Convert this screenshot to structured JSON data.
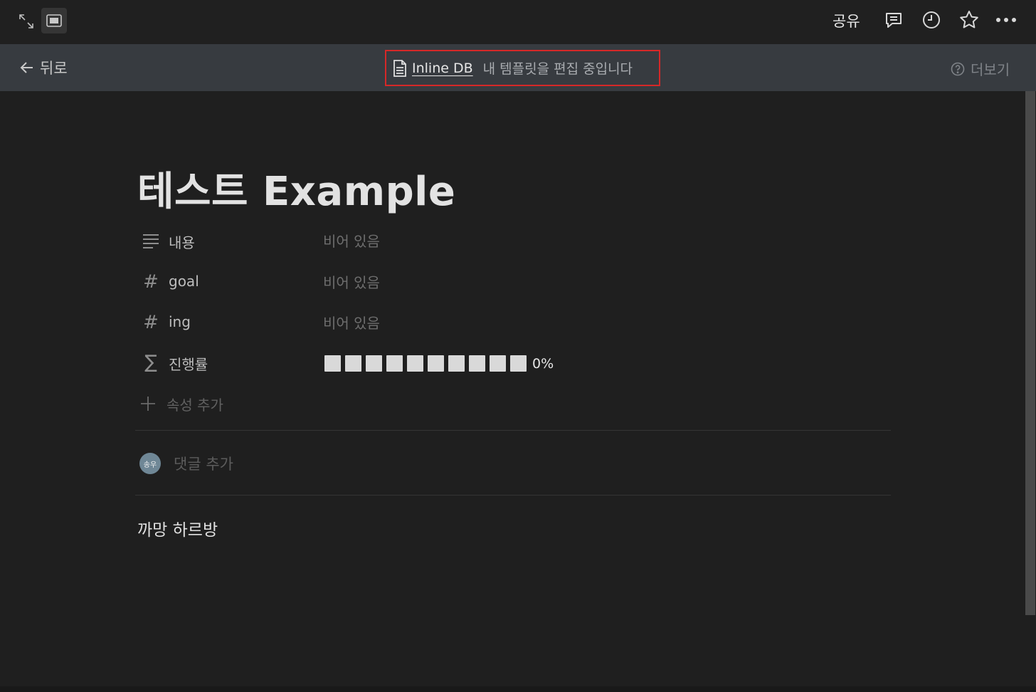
{
  "topbar": {
    "share_label": "공유",
    "icons": [
      "expand-icon",
      "peek-mode-icon",
      "comment-icon",
      "clock-icon",
      "star-icon",
      "more-icon"
    ]
  },
  "banner": {
    "back_label": "뒤로",
    "db_name": "Inline DB",
    "message": "내 템플릿을 편집 중입니다",
    "more_label": "더보기"
  },
  "page": {
    "title": "테스트 Example",
    "properties": [
      {
        "icon": "text-lines-icon",
        "name": "내용",
        "value": "비어 있음"
      },
      {
        "icon": "number-hash-icon",
        "name": "goal",
        "value": "비어 있음"
      },
      {
        "icon": "number-hash-icon",
        "name": "ing",
        "value": "비어 있음"
      },
      {
        "icon": "sigma-formula-icon",
        "name": "진행률",
        "progress_percent": 0,
        "progress_label": "0%"
      }
    ],
    "add_property_label": "속성 추가",
    "comment": {
      "avatar_text": "송우",
      "placeholder": "댓글 추가"
    },
    "body": "까망 하르방"
  },
  "colors": {
    "topbar": "#202020",
    "banner": "#373b40",
    "content_bg": "#1f1f1f",
    "highlight_border": "#d62828",
    "progress_square": "#d9d9d9"
  }
}
